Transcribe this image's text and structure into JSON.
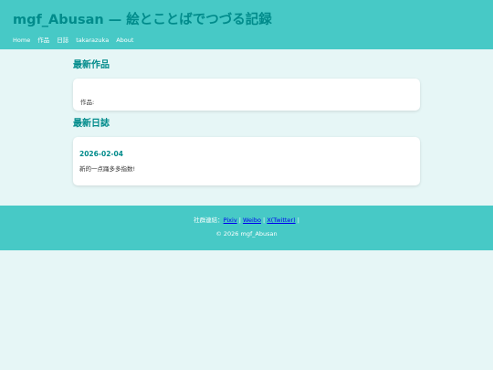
{
  "header": {
    "site_title": "mgf_Abusan — 絵とことばでつづる記録",
    "nav": {
      "home": "Home",
      "works": "作品",
      "diary": "日誌",
      "takarazuka": "takarazuka",
      "about": "About"
    }
  },
  "main": {
    "latest_works": {
      "title": "最新作品",
      "label": "作品:"
    },
    "latest_diary": {
      "title": "最新日誌",
      "entry": {
        "date": "2026-02-04",
        "text": "新的一点踊多多指数!"
      }
    }
  },
  "footer": {
    "social_label": "社群連結：",
    "links": {
      "pixiv": "Pixiv",
      "weibo": "Weibo",
      "twitter": "X(Twitter)"
    },
    "sep1": " | ",
    "sep2": " | ",
    "sep3": " |",
    "copyright": "© 2026 mgf_Abusan"
  },
  "colors": {
    "header_bg": "#47c9c6",
    "accent": "#008b8b",
    "page_bg": "#e6f6f6",
    "link": "#0000ee"
  }
}
